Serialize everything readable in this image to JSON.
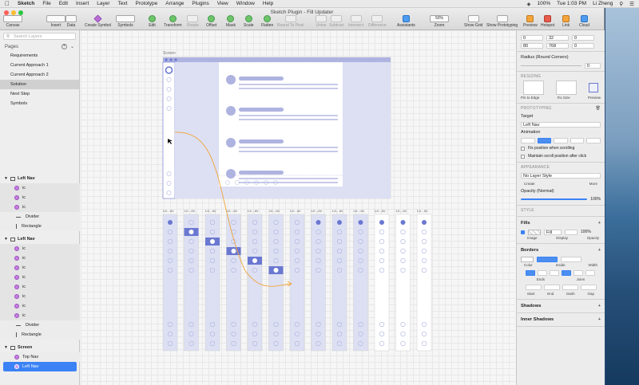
{
  "menubar": {
    "app": "Sketch",
    "items": [
      "File",
      "Edit",
      "Insert",
      "Layer",
      "Text",
      "Prototype",
      "Arrange",
      "Plugins",
      "View",
      "Window",
      "Help"
    ],
    "status": "100%",
    "clock": "Tue 1:03 PM",
    "user": "Li Zheng"
  },
  "window": {
    "title": "Sketch Plugin - Fill Updater"
  },
  "toolbar": {
    "tools": [
      "Canvas",
      "Insert",
      "Data",
      "Create Symbol",
      "Symbols",
      "Edit",
      "Transform",
      "Rotate",
      "Offset",
      "Mask",
      "Scale",
      "Flatten",
      "Round To Pixel",
      "Union",
      "Subtract",
      "Intersect",
      "Difference",
      "Assistants",
      "Zoom",
      "Show Grid",
      "Show Prototyping",
      "Preview",
      "Hotspot",
      "Link",
      "Cloud"
    ],
    "zoom_value": "50%"
  },
  "sidebar": {
    "search_placeholder": "Search Layers",
    "pages_label": "Pages",
    "pages": [
      "Requirements",
      "Current Approach 1",
      "Current Approach 2",
      "Solution",
      "Next Step",
      "Symbols"
    ],
    "selected_page": 3,
    "layers": {
      "group1": "Left Nav",
      "group1_items": [
        "ic",
        "ic",
        "ic",
        "Divider",
        "Rectangle"
      ],
      "group2": "Left Nav",
      "group2_items": [
        "ic",
        "ic",
        "ic",
        "ic",
        "ic",
        "ic",
        "ic",
        "ic",
        "Divider",
        "Rectangle"
      ],
      "screen": "Screen",
      "screen_items": [
        "Top Nav",
        "Left Nav"
      ]
    }
  },
  "canvas": {
    "artboard_label": "Screen",
    "column_labels": [
      "Le...av",
      "Le...av",
      "Le...av",
      "Le...av",
      "Le...av",
      "Le...av",
      "Le...av",
      "Le...av",
      "Le...av",
      "Le...av",
      "Le...av",
      "Le...av",
      "Le...av"
    ],
    "filled_row_per_column": [
      0,
      1,
      2,
      3,
      4,
      5,
      6,
      0,
      0,
      0,
      0,
      0,
      0
    ],
    "colors": {
      "accent": "#6a78d1",
      "light": "#dde0f3",
      "artboard_bg": "#ffffff",
      "curve": "#f0a43a"
    }
  },
  "inspector": {
    "pos": [
      "0",
      "32",
      "0"
    ],
    "size": [
      "80",
      "768",
      "0"
    ],
    "radius_label": "Radius (Round Corners)",
    "radius_value": "0",
    "resizing_title": "RESIZING",
    "resizing_labels": [
      "Pin to Edge",
      "Fix Size",
      "Preview"
    ],
    "prototyping_title": "PROTOTYPING",
    "target_label": "Target",
    "target_value": "Left Nav",
    "animation_label": "Animation",
    "fix_position": "Fix position when scrolling",
    "maintain_scroll": "Maintain scroll position after click",
    "appearance_title": "APPEARANCE",
    "layer_style": "No Layer Style",
    "style_actions": [
      "Create",
      "",
      "",
      "More"
    ],
    "opacity_label": "Opacity (Normal)",
    "opacity_value": "100%",
    "opacity_fraction": 1.0,
    "style_title": "STYLE",
    "fills_label": "Fills",
    "fill_mode": "Fill",
    "fill_opacity": "100%",
    "fill_sublabels": [
      "Image",
      "Display",
      "Opacity"
    ],
    "borders_label": "Borders",
    "border_sublabels": [
      "Color",
      "Inside",
      "Width"
    ],
    "ends_joins": [
      "Ends",
      "Joins"
    ],
    "arrow_labels": [
      "Start",
      "End",
      "Dash",
      "Gap"
    ],
    "shadows_label": "Shadows",
    "inner_shadows_label": "Inner Shadows"
  }
}
